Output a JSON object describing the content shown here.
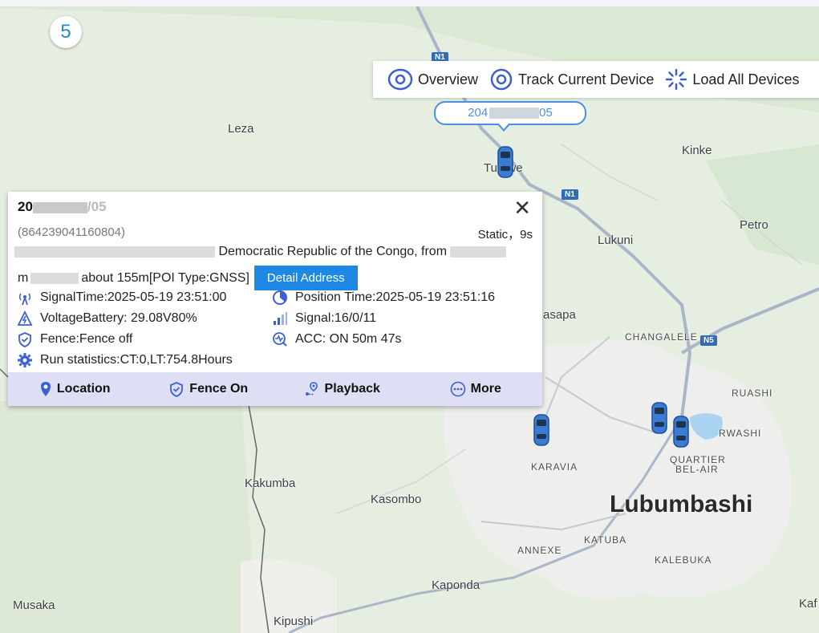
{
  "counter": "5",
  "toolbar": {
    "overview": "Overview",
    "track_current": "Track Current Device",
    "load_all": "Load All Devices"
  },
  "device_tag": {
    "prefix": "204",
    "suffix": "05"
  },
  "popup": {
    "title_prefix": "20",
    "title_suffix": "/05",
    "imei": "(864239041160804)",
    "status": "Static，9s",
    "address_line1": "Democratic Republic of the Congo, from",
    "address_line2": "about 155m[POI Type:GNSS]",
    "address_line2_prefix": "m",
    "detail_button": "Detail Address",
    "signal_time": "SignalTime:2025-05-19 23:51:00",
    "position_time": "Position Time:2025-05-19 23:51:16",
    "voltage": "VoltageBattery: 29.08V80%",
    "signal": "Signal:16/0/11",
    "fence": "Fence:Fence off",
    "acc": "ACC: ON 50m 47s",
    "run_stats": "Run statistics:CT:0,LT:754.8Hours",
    "actions": {
      "location": "Location",
      "fence_on": "Fence On",
      "playback": "Playback",
      "more": "More"
    }
  },
  "map": {
    "labels": {
      "leza": "Leza",
      "kinke": "Kinke",
      "tumbwe": "Tu owe",
      "petro": "Petro",
      "lukuni": "Lukuni",
      "kasapa": "asapa",
      "changalele": "CHANGALELE",
      "ruashi": "RUASHI",
      "rwashi": "RWASHI",
      "quartier": "QUARTIER",
      "belair": "BEL-AIR",
      "karavia": "KARAVIA",
      "kakumba": "Kakumba",
      "kasombo": "Kasombo",
      "lubumbashi": "Lubumbashi",
      "annexe": "ANNEXE",
      "katuba": "KATUBA",
      "kalebuka": "KALEBUKA",
      "kaponda": "Kaponda",
      "musaka": "Musaka",
      "kipushi": "Kipushi",
      "kaf": "Kaf"
    },
    "shields": {
      "n1_top": "N1",
      "n1_mid": "N1",
      "n5": "N5"
    }
  }
}
